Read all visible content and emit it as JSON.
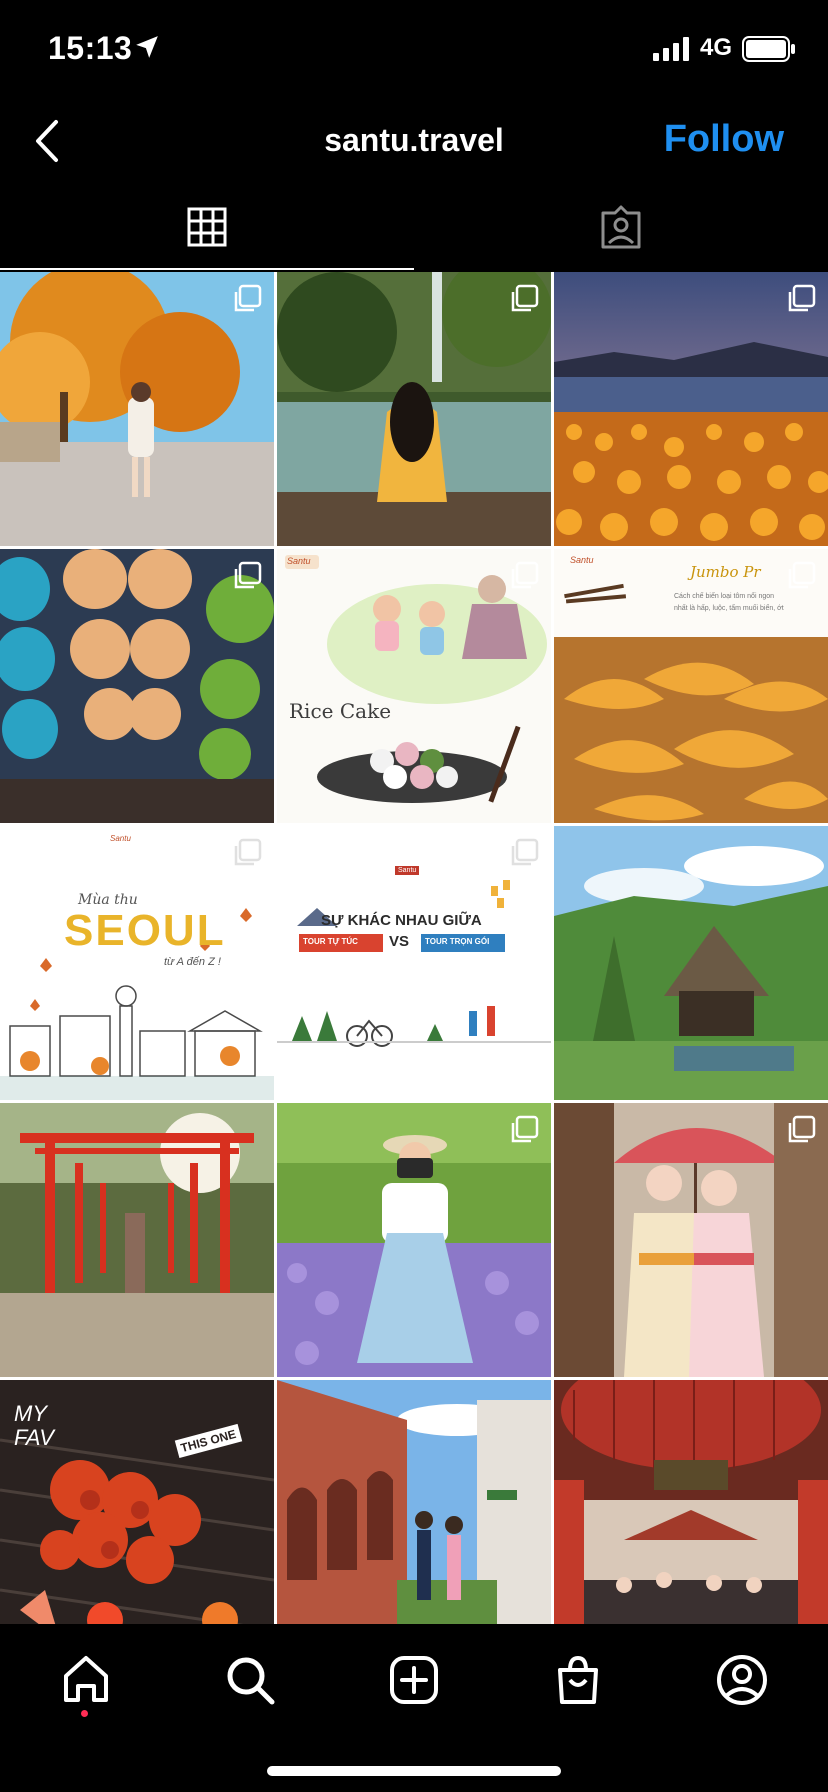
{
  "status_bar": {
    "time": "15:13",
    "network": "4G"
  },
  "header": {
    "title": "santu.travel",
    "follow_label": "Follow"
  },
  "tabs": [
    {
      "name": "grid",
      "active": true
    },
    {
      "name": "tagged",
      "active": false
    }
  ],
  "posts": [
    {
      "id": "p1",
      "subject": "autumn street portrait",
      "multi": true
    },
    {
      "id": "p2",
      "subject": "waterfall lake girl",
      "multi": true
    },
    {
      "id": "p3",
      "subject": "lantern lake sunset",
      "multi": true
    },
    {
      "id": "p4",
      "subject": "paper lanterns",
      "multi": true
    },
    {
      "id": "p5",
      "subject": "rice cake illustration",
      "multi": true,
      "texts": {
        "logo": "Santu",
        "heading": "Rice Cake"
      }
    },
    {
      "id": "p6",
      "subject": "jumbo prawns",
      "multi": true,
      "texts": {
        "logo": "Santu",
        "heading": "Jumbo Pr",
        "line1": "Cách chế biến loại tôm nổi ngon",
        "line2": "nhất là hấp, luộc, tẩm muối biển, ớt"
      }
    },
    {
      "id": "p7",
      "subject": "seoul autumn illustration",
      "multi": true,
      "texts": {
        "logo": "Santu",
        "line1": "Mùa thu",
        "heading": "SEOUL",
        "line2": "từ A đến Z !"
      }
    },
    {
      "id": "p8",
      "subject": "travel comparison",
      "multi": true,
      "texts": {
        "logo": "Santu",
        "heading": "SỰ KHÁC NHAU GIỮA",
        "left": "TOUR TỰ TÚC",
        "vs": "VS",
        "right": "TOUR TRỌN GÓI"
      }
    },
    {
      "id": "p9",
      "subject": "thatched house village",
      "multi": false
    },
    {
      "id": "p10",
      "subject": "red torii gates",
      "multi": false
    },
    {
      "id": "p11",
      "subject": "hanbok in lavender",
      "multi": true
    },
    {
      "id": "p12",
      "subject": "kimono umbrella",
      "multi": true
    },
    {
      "id": "p13",
      "subject": "spicy octopus",
      "multi": false,
      "texts": {
        "tag1": "MY FAV",
        "tag2": "THIS ONE"
      }
    },
    {
      "id": "p14",
      "subject": "brick arches couple",
      "multi": false
    },
    {
      "id": "p15",
      "subject": "temple red lantern",
      "multi": false
    }
  ],
  "bottom_nav": [
    {
      "name": "home-icon",
      "active": true
    },
    {
      "name": "search-icon",
      "active": false
    },
    {
      "name": "add-post-icon",
      "active": false
    },
    {
      "name": "shop-icon",
      "active": false
    },
    {
      "name": "profile-icon",
      "active": false
    }
  ],
  "colors": {
    "follow": "#1f8ff0",
    "home_dot": "#ff2d55",
    "background": "#000000"
  }
}
